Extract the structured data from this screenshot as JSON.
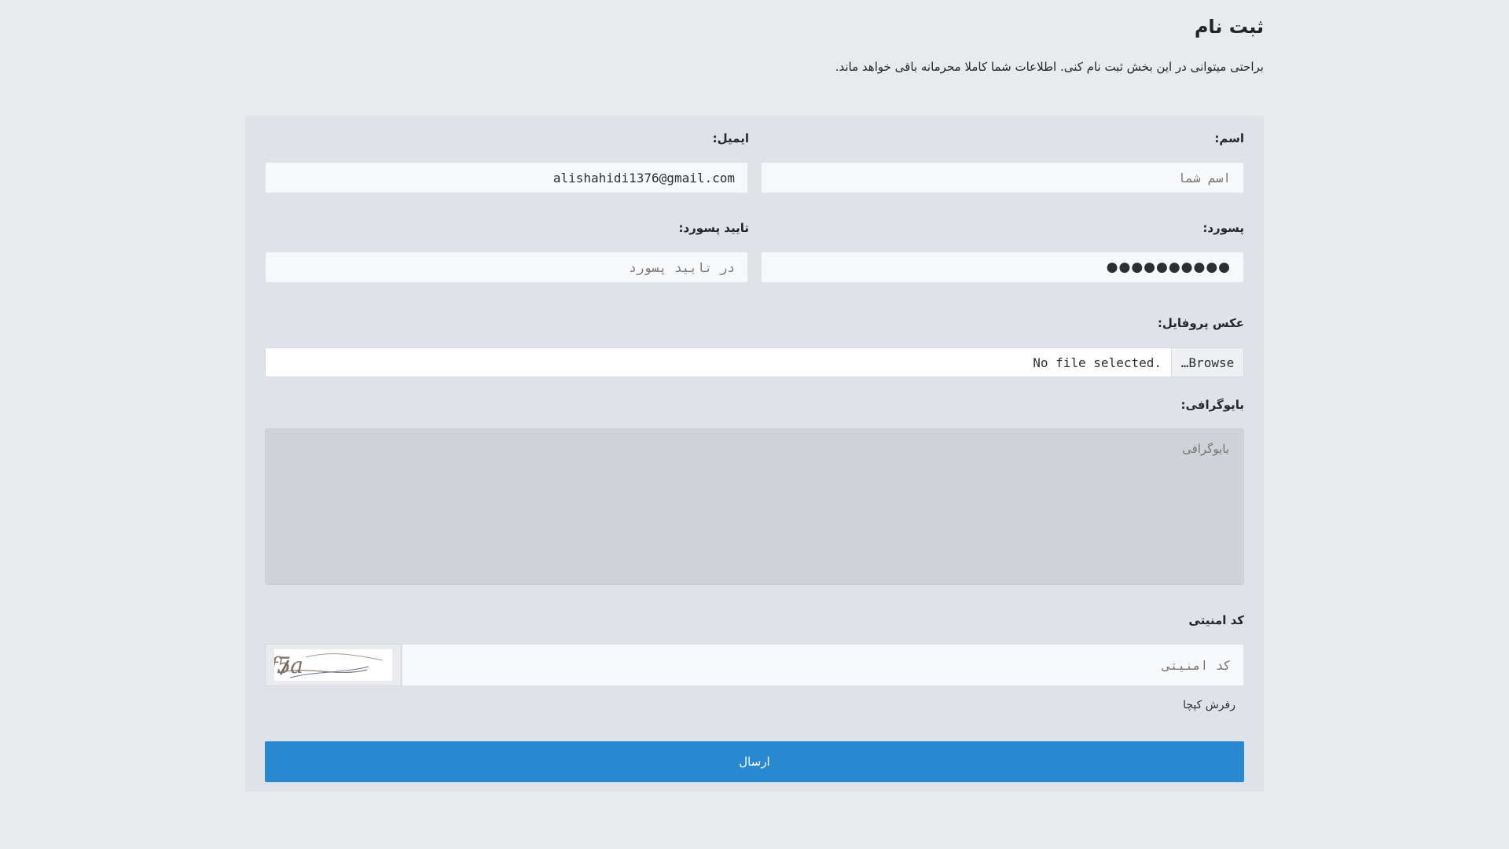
{
  "header": {
    "title": "ثبت نام",
    "subtitle": "براحتی میتوانی در این بخش ثبت نام کنی. اطلاعات شما کاملا محرمانه باقی خواهد ماند."
  },
  "form": {
    "name": {
      "label": "اسم:",
      "placeholder": "اسم شما",
      "value": ""
    },
    "email": {
      "label": "ایمیل:",
      "value": "alishahidi1376@gmail.com"
    },
    "password": {
      "label": "پسورد:",
      "value": "●●●●●●●●●●"
    },
    "confirm_password": {
      "label": "تایید پسورد:",
      "placeholder": "در تایید پسورد",
      "value": ""
    },
    "profile_photo": {
      "label": "عکس پروفایل:",
      "browse_label": "Browse…",
      "status": "No file selected."
    },
    "biography": {
      "label": "بایوگرافی:",
      "placeholder": "بایوگرافی",
      "value": ""
    },
    "captcha": {
      "label": "کد امنیتی",
      "placeholder": "کد امنیتی",
      "image_text": "Xlf5a",
      "refresh_label": "رفرش کپچا"
    },
    "submit_label": "ارسال"
  },
  "colors": {
    "page_bg": "#e8ebee",
    "card_bg": "#dfe2e6",
    "accent": "#2889d1"
  }
}
